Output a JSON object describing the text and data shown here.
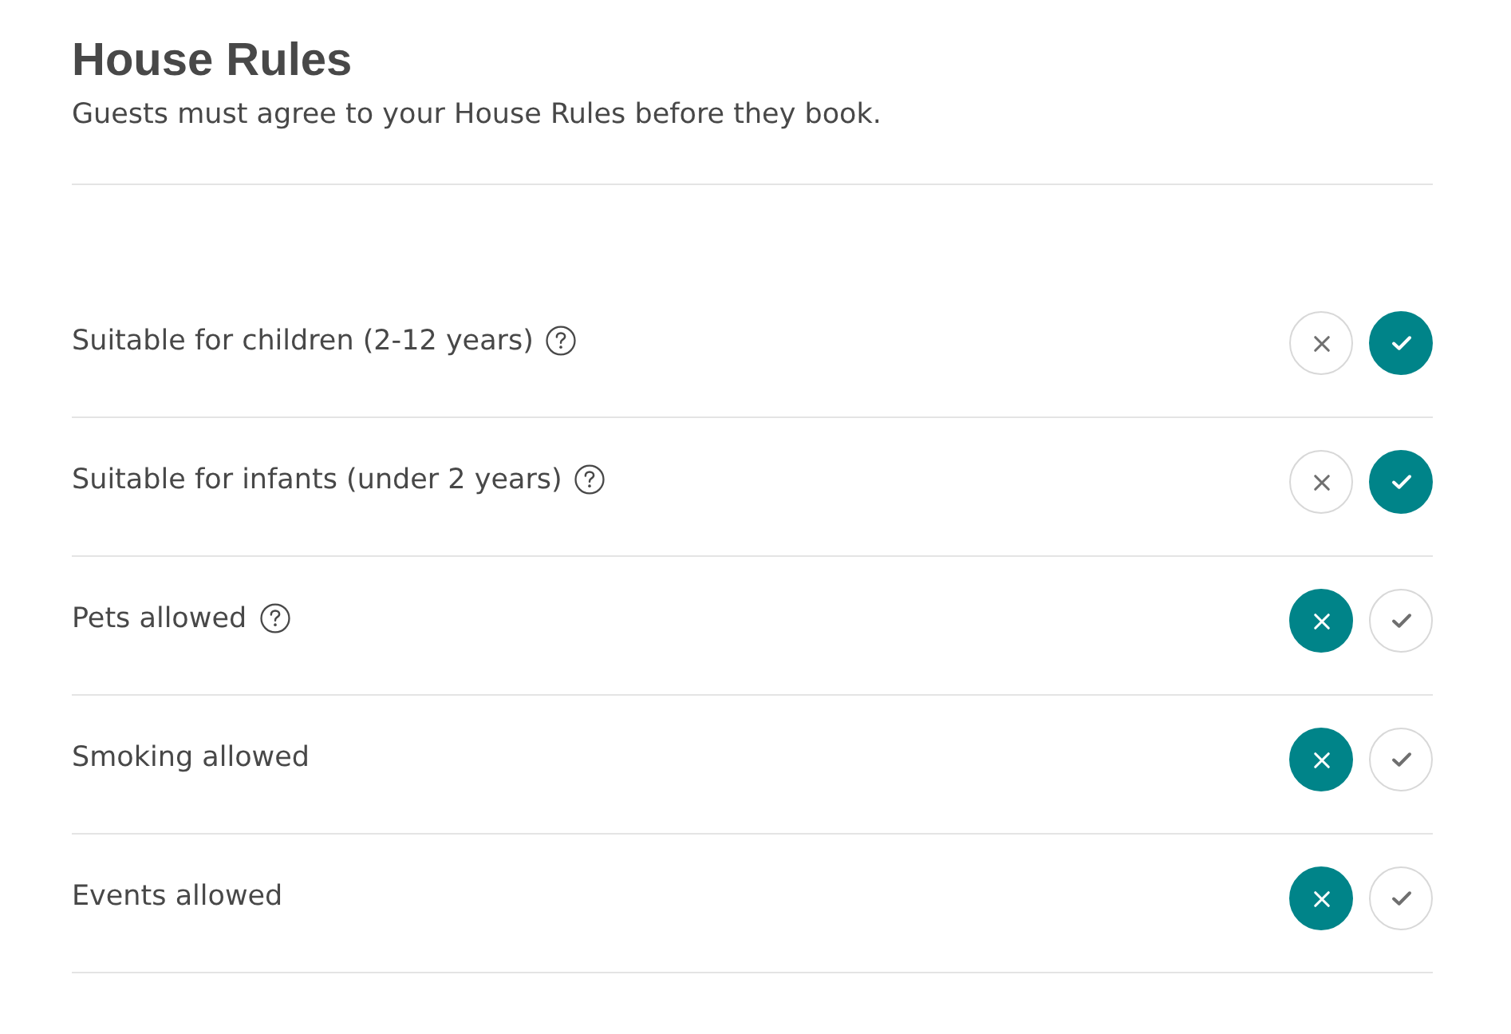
{
  "title": "House Rules",
  "subtitle": "Guests must agree to your House Rules before they book.",
  "rules": [
    {
      "label": "Suitable for children (2-12 years)",
      "help_icon": true,
      "choices": [
        {
          "kind": "no",
          "selected": false
        },
        {
          "kind": "yes",
          "selected": true
        }
      ]
    },
    {
      "label": "Suitable for infants (under 2 years)",
      "help_icon": true,
      "choices": [
        {
          "kind": "no",
          "selected": false
        },
        {
          "kind": "yes",
          "selected": true
        }
      ]
    },
    {
      "label": "Pets allowed",
      "help_icon": true,
      "choices": [
        {
          "kind": "no",
          "selected": true
        },
        {
          "kind": "yes",
          "selected": false
        }
      ]
    },
    {
      "label": "Smoking allowed",
      "help_icon": false,
      "choices": [
        {
          "kind": "no",
          "selected": true
        },
        {
          "kind": "yes",
          "selected": false
        }
      ]
    },
    {
      "label": "Events allowed",
      "help_icon": false,
      "choices": [
        {
          "kind": "no",
          "selected": true
        },
        {
          "kind": "yes",
          "selected": false
        }
      ]
    }
  ]
}
